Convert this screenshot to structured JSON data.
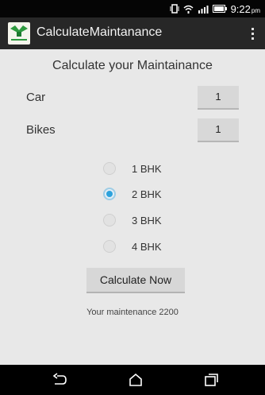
{
  "status_bar": {
    "time": "9:22",
    "ampm": "pm"
  },
  "app": {
    "title": "CalculateMaintanance"
  },
  "form": {
    "heading": "Calculate your Maintainance",
    "car": {
      "label": "Car",
      "value": "1"
    },
    "bikes": {
      "label": "Bikes",
      "value": "1"
    },
    "options": [
      {
        "label": "1 BHK",
        "checked": false
      },
      {
        "label": "2 BHK",
        "checked": true
      },
      {
        "label": "3 BHK",
        "checked": false
      },
      {
        "label": "4 BHK",
        "checked": false
      }
    ],
    "calculate_label": "Calculate Now",
    "result_text": "Your maintenance 2200"
  },
  "colors": {
    "accent": "#2da2dc",
    "background": "#e8e8e8",
    "action_bar": "#272727"
  },
  "icons": [
    "vibrate-icon",
    "wifi-icon",
    "signal-icon",
    "battery-icon",
    "app-logo-icon",
    "overflow-menu-icon",
    "back-icon",
    "home-icon",
    "recent-apps-icon"
  ]
}
